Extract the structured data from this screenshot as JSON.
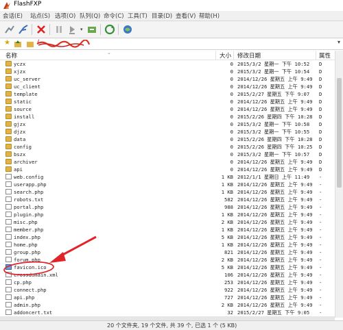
{
  "window": {
    "title": "FlashFXP"
  },
  "menu": [
    "会话(E)",
    "站点(S)",
    "选项(O)",
    "队列(Q)",
    "命令(C)",
    "工具(T)",
    "目录(D)",
    "查看(V)",
    "帮助(H)"
  ],
  "toolbar_icons": [
    "connect-icon",
    "quick-connect-icon",
    "disconnect-icon",
    "pause-icon",
    "transfer-icon",
    "refresh-icon",
    "site-manager-icon",
    "refresh-icon",
    "remote-browse-icon"
  ],
  "path": {
    "value": "/"
  },
  "columns": {
    "name": "名称",
    "size": "大小",
    "date": "修改日期",
    "attr": "属性"
  },
  "files": [
    {
      "name": "yczx",
      "type": "folder",
      "size": "0",
      "date": "2015/3/2 星期一 下午 10:52",
      "attr": "D"
    },
    {
      "name": "xjzx",
      "type": "folder",
      "size": "0",
      "date": "2015/3/2 星期一 下午 10:54",
      "attr": "D"
    },
    {
      "name": "uc_server",
      "type": "folder",
      "size": "0",
      "date": "2014/12/26 星期五 上午 9:49",
      "attr": "D"
    },
    {
      "name": "uc_client",
      "type": "folder",
      "size": "0",
      "date": "2014/12/26 星期五 上午 9:49",
      "attr": "D"
    },
    {
      "name": "template",
      "type": "folder",
      "size": "0",
      "date": "2015/2/27 星期五 下午 9:07",
      "attr": "D"
    },
    {
      "name": "static",
      "type": "folder",
      "size": "0",
      "date": "2014/12/26 星期五 上午 9:49",
      "attr": "D"
    },
    {
      "name": "source",
      "type": "folder",
      "size": "0",
      "date": "2014/12/26 星期五 上午 9:49",
      "attr": "D"
    },
    {
      "name": "install",
      "type": "folder",
      "size": "0",
      "date": "2015/2/26 星期四 下午 10:28",
      "attr": "D"
    },
    {
      "name": "gjzx",
      "type": "folder",
      "size": "0",
      "date": "2015/3/2 星期一 下午 10:58",
      "attr": "D"
    },
    {
      "name": "djzx",
      "type": "folder",
      "size": "0",
      "date": "2015/3/2 星期一 下午 10:55",
      "attr": "D"
    },
    {
      "name": "data",
      "type": "folder",
      "size": "0",
      "date": "2015/2/26 星期四 下午 10:28",
      "attr": "D"
    },
    {
      "name": "config",
      "type": "folder",
      "size": "0",
      "date": "2015/2/26 星期四 下午 10:25",
      "attr": "D"
    },
    {
      "name": "bszx",
      "type": "folder",
      "size": "0",
      "date": "2015/3/2 星期一 下午 10:57",
      "attr": "D"
    },
    {
      "name": "archiver",
      "type": "folder",
      "size": "0",
      "date": "2014/12/26 星期五 上午 9:49",
      "attr": "D"
    },
    {
      "name": "api",
      "type": "folder",
      "size": "0",
      "date": "2014/12/26 星期五 上午 9:49",
      "attr": "D"
    },
    {
      "name": "web.config",
      "type": "file",
      "size": "1 KB",
      "date": "2012/1/1 星期日 上午 11:49",
      "attr": "-"
    },
    {
      "name": "userapp.php",
      "type": "file",
      "size": "1 KB",
      "date": "2014/12/26 星期五 上午 9:49",
      "attr": "-"
    },
    {
      "name": "search.php",
      "type": "file",
      "size": "1 KB",
      "date": "2014/12/26 星期五 上午 9:49",
      "attr": "-"
    },
    {
      "name": "robots.txt",
      "type": "file",
      "size": "582",
      "date": "2014/12/26 星期五 上午 9:49",
      "attr": "-"
    },
    {
      "name": "portal.php",
      "type": "file",
      "size": "988",
      "date": "2014/12/26 星期五 上午 9:49",
      "attr": "-"
    },
    {
      "name": "plugin.php",
      "type": "file",
      "size": "1 KB",
      "date": "2014/12/26 星期五 上午 9:49",
      "attr": "-"
    },
    {
      "name": "misc.php",
      "type": "file",
      "size": "2 KB",
      "date": "2014/12/26 星期五 上午 9:49",
      "attr": "-"
    },
    {
      "name": "member.php",
      "type": "file",
      "size": "1 KB",
      "date": "2014/12/26 星期五 上午 9:49",
      "attr": "-"
    },
    {
      "name": "index.php",
      "type": "file",
      "size": "5 KB",
      "date": "2014/12/26 星期五 上午 9:49",
      "attr": "-"
    },
    {
      "name": "home.php",
      "type": "file",
      "size": "1 KB",
      "date": "2014/12/26 星期五 上午 9:49",
      "attr": "-"
    },
    {
      "name": "group.php",
      "type": "file",
      "size": "821",
      "date": "2014/12/26 星期五 上午 9:49",
      "attr": "-"
    },
    {
      "name": "forum.php",
      "type": "file",
      "size": "2 KB",
      "date": "2014/12/26 星期五 上午 9:49",
      "attr": "-"
    },
    {
      "name": "favicon.ico",
      "type": "ico",
      "size": "5 KB",
      "date": "2014/12/26 星期五 上午 9:49",
      "attr": "-"
    },
    {
      "name": "crossdomain.xml",
      "type": "file",
      "size": "106",
      "date": "2014/12/26 星期五 上午 9:49",
      "attr": "-"
    },
    {
      "name": "cp.php",
      "type": "file",
      "size": "253",
      "date": "2014/12/26 星期五 上午 9:49",
      "attr": "-"
    },
    {
      "name": "connect.php",
      "type": "file",
      "size": "922",
      "date": "2014/12/26 星期五 上午 9:49",
      "attr": "-"
    },
    {
      "name": "api.php",
      "type": "file",
      "size": "727",
      "date": "2014/12/26 星期五 上午 9:49",
      "attr": "-"
    },
    {
      "name": "admin.php",
      "type": "file",
      "size": "2 KB",
      "date": "2014/12/26 星期五 上午 9:49",
      "attr": "-"
    },
    {
      "name": "addoncert.txt",
      "type": "file",
      "size": "32",
      "date": "2015/2/27 星期五 下午 9:05",
      "attr": "-"
    }
  ],
  "status": "20 个文件夹, 19 个文件, 共 39 个, 已选 1 个 (5 KB)",
  "colors": {
    "folder": "#e3b445",
    "annotation": "#e0242a",
    "selection_circle": "#e0242a"
  }
}
